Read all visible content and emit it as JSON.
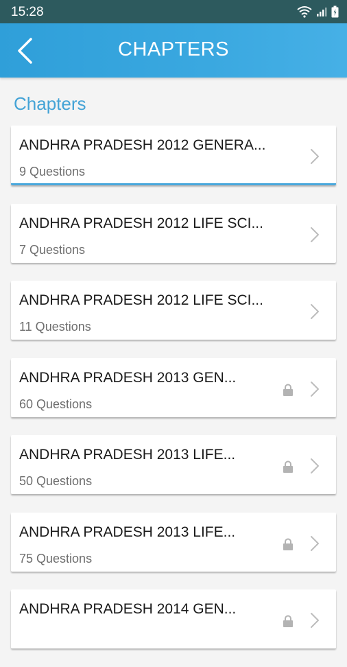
{
  "status_bar": {
    "time": "15:28"
  },
  "app_bar": {
    "title": "CHAPTERS"
  },
  "section_title": "Chapters",
  "chapters": [
    {
      "title": "ANDHRA PRADESH 2012 GENERA...",
      "subtitle": "9 Questions",
      "locked": false
    },
    {
      "title": "ANDHRA PRADESH 2012 LIFE SCI...",
      "subtitle": "7 Questions",
      "locked": false
    },
    {
      "title": "ANDHRA PRADESH 2012 LIFE SCI...",
      "subtitle": "11 Questions",
      "locked": false
    },
    {
      "title": "ANDHRA PRADESH 2013 GEN...",
      "subtitle": "60 Questions",
      "locked": true
    },
    {
      "title": "ANDHRA PRADESH 2013 LIFE...",
      "subtitle": "50 Questions",
      "locked": true
    },
    {
      "title": "ANDHRA PRADESH 2013 LIFE...",
      "subtitle": "75 Questions",
      "locked": true
    },
    {
      "title": "ANDHRA PRADESH 2014 GEN...",
      "subtitle": "",
      "locked": true
    }
  ],
  "colors": {
    "status_bar": "#2d5a5e",
    "app_bar": "#3aa8e0",
    "accent": "#44a3d6"
  }
}
